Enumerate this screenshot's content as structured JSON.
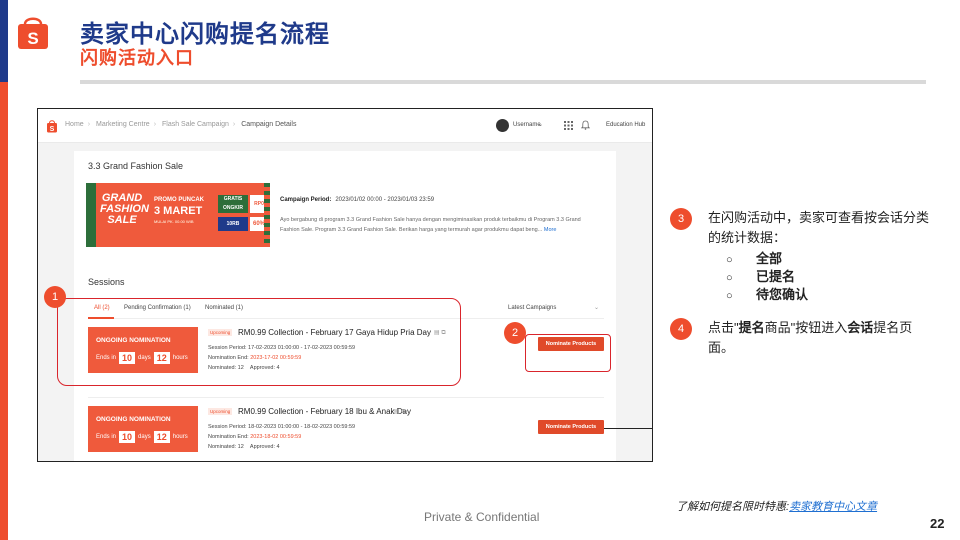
{
  "slide": {
    "title": "卖家中心闪购提名流程",
    "subtitle": "闪购活动入口",
    "footer": "Private & Confidential",
    "page_number": "22",
    "learn_prefix": "了解如何提名限时特惠:",
    "learn_link": "卖家教育中心文章",
    "colors": {
      "brand": "#ee4d2d",
      "title_blue": "#1f3a8a"
    }
  },
  "app": {
    "breadcrumbs": [
      "Home",
      "Marketing Centre",
      "Flash Sale Campaign",
      "Campaign Details"
    ],
    "username": "Username",
    "education_hub": "Education Hub",
    "campaign": {
      "title": "3.3 Grand Fashion Sale",
      "banner": {
        "grand": "GRAND FASHION SALE",
        "promo": "PROMO PUNCAK",
        "date": "3 MARET",
        "date_sub": "MULAI PK. 00.00 WIB",
        "gratis": "GRATIS ONGKIR",
        "rp": "RP0",
        "tenrb": "10RB",
        "pct": "60%"
      },
      "period_label": "Campaign Period:",
      "period_value": "2023/01/02 00:00 - 2023/01/03 23:59",
      "description": "Ayo bergabung di program 3.3 Grand Fashion Sale hanya dengan mengiminasikan produk terbaikmu di Program 3.3 Grand Fashion Sale. Program 3.3 Grand Fashion Sale. Berikan harga yang termurah agar produkmu dapat beng...",
      "more": "More"
    },
    "sessions": {
      "title": "Sessions",
      "tabs": [
        "All (2)",
        "Pending Confirmation (1)",
        "Nominated (1)"
      ],
      "sort": "Latest Campaigns",
      "rows": [
        {
          "status_title": "ONGOING NOMINATION",
          "ends_in": "Ends in",
          "days": "10",
          "days_label": "days",
          "hours": "12",
          "hours_label": "hours",
          "badge": "Upcoming",
          "name": "RM0.99 Collection - February 17 Gaya Hidup Pria Day",
          "period": "Session Period: 17-02-2023 01:00:00 - 17-02-2023 00:59:59",
          "nom_end_label": "Nomination End:",
          "nom_end_value": "2023-17-02 00:59:59",
          "nominated": "Nominated: 12",
          "approved": "Approved: 4",
          "button": "Nominate Products"
        },
        {
          "status_title": "ONGOING NOMINATION",
          "ends_in": "Ends in",
          "days": "10",
          "days_label": "days",
          "hours": "12",
          "hours_label": "hours",
          "badge": "Upcoming",
          "name": "RM0.99 Collection - February 18 Ibu & Anak Day",
          "period": "Session Period: 18-02-2023 01:00:00 - 18-02-2023 00:59:59",
          "nom_end_label": "Nomination End:",
          "nom_end_value": "2023-18-02 00:59:59",
          "nominated": "Nominated: 12",
          "approved": "Approved: 4",
          "button": "Nominate Products"
        }
      ]
    }
  },
  "callouts": {
    "n1": "1",
    "n2": "2",
    "n3": "3",
    "n4": "4",
    "note3": "在闪购活动中，卖家可查看按会话分类的统计数据：",
    "bullets": [
      "全部",
      "已提名",
      "待您确认"
    ],
    "bullet_mark": "○",
    "note4_a": "点击\"",
    "note4_b": "提名",
    "note4_c": "商品\"按钮进入",
    "note4_d": "会话",
    "note4_e": "提名页面。"
  }
}
